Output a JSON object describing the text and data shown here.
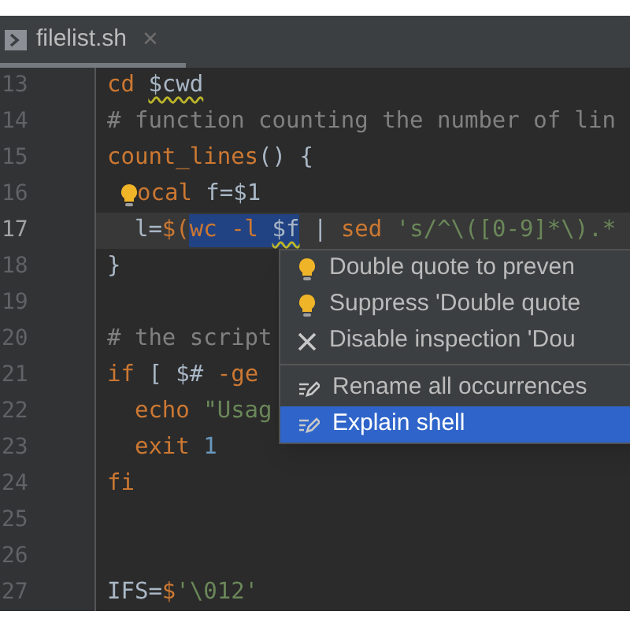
{
  "tab": {
    "title": "filelist.sh",
    "close": "×",
    "selected": true
  },
  "lines": [
    {
      "number": "13",
      "current": false,
      "tokens": [
        {
          "t": "cd ",
          "kind": "keyword"
        },
        {
          "t": "$cwd",
          "kind": "plain",
          "warning": true
        }
      ]
    },
    {
      "number": "14",
      "current": false,
      "tokens": [
        {
          "t": "# function counting the number of lin",
          "kind": "comment"
        }
      ]
    },
    {
      "number": "15",
      "current": false,
      "tokens": [
        {
          "t": "count_lines",
          "kind": "keyword"
        },
        {
          "t": "() {",
          "kind": "plain"
        }
      ]
    },
    {
      "number": "16",
      "current": false,
      "tokens": [
        {
          "kind": "bulb"
        },
        {
          "t": "ocal",
          "kind": "keyword"
        },
        {
          "t": " f=$1",
          "kind": "plain"
        }
      ]
    },
    {
      "number": "17",
      "current": true,
      "tokens": [
        {
          "t": "  l=",
          "kind": "plain"
        },
        {
          "t": "$(",
          "kind": "keyword"
        },
        {
          "t": "wc -l ",
          "kind": "keyword",
          "selected": true
        },
        {
          "t": "$f",
          "kind": "plain",
          "selected": true,
          "warning": true
        },
        {
          "t": " | ",
          "kind": "plain"
        },
        {
          "t": "sed ",
          "kind": "keyword"
        },
        {
          "t": "'s/^\\([0-9]*\\).*",
          "kind": "string"
        }
      ]
    },
    {
      "number": "18",
      "current": false,
      "tokens": [
        {
          "t": "}",
          "kind": "plain"
        }
      ]
    },
    {
      "number": "19",
      "current": false
    },
    {
      "number": "20",
      "current": false,
      "tokens": [
        {
          "t": "# the script",
          "kind": "comment"
        }
      ]
    },
    {
      "number": "21",
      "current": false,
      "tokens": [
        {
          "t": "if",
          "kind": "keyword"
        },
        {
          "t": " [ $# ",
          "kind": "plain"
        },
        {
          "t": "-ge",
          "kind": "keyword"
        }
      ]
    },
    {
      "number": "22",
      "current": false,
      "tokens": [
        {
          "t": "  echo ",
          "kind": "keyword"
        },
        {
          "t": "\"Usag",
          "kind": "string"
        }
      ]
    },
    {
      "number": "23",
      "current": false,
      "tokens": [
        {
          "t": "  exit ",
          "kind": "keyword"
        },
        {
          "t": "1",
          "kind": "number"
        }
      ]
    },
    {
      "number": "24",
      "current": false,
      "tokens": [
        {
          "t": "fi",
          "kind": "keyword"
        }
      ]
    },
    {
      "number": "25",
      "current": false
    },
    {
      "number": "26",
      "current": false
    },
    {
      "number": "27",
      "current": false,
      "tokens": [
        {
          "t": "IFS=",
          "kind": "plain"
        },
        {
          "t": "$",
          "kind": "keyword"
        },
        {
          "t": "'\\012'",
          "kind": "string"
        }
      ]
    }
  ],
  "menu": [
    {
      "label": "Double quote to preven",
      "kind": "bulb",
      "selected": false
    },
    {
      "label": "Suppress 'Double quote",
      "kind": "bulb",
      "selected": false
    },
    {
      "label": "Disable inspection 'Dou",
      "kind": "disable",
      "selected": false
    },
    {
      "kind": "separator"
    },
    {
      "label": "Rename all occurrences",
      "kind": "edit",
      "selected": false
    },
    {
      "label": "Explain shell",
      "kind": "edit",
      "selected": true
    }
  ]
}
